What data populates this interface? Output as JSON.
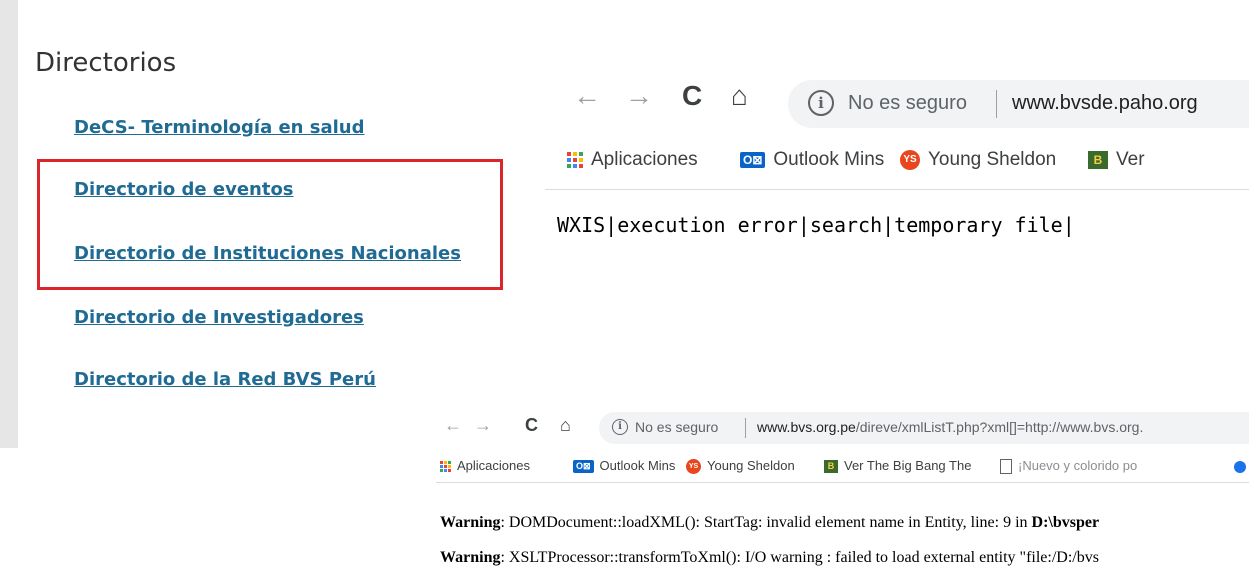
{
  "directorios": {
    "title": "Directorios",
    "links": [
      "DeCS- Terminología en salud",
      "Directorio de eventos",
      "Directorio de Instituciones Nacionales",
      "Directorio de Investigadores",
      "Directorio de la Red BVS Perú"
    ]
  },
  "browser1": {
    "nav": {
      "back": "←",
      "forward": "→",
      "reload": "C",
      "home": "⌂"
    },
    "info": "i",
    "security": "No es seguro",
    "url": "www.bvsde.paho.org",
    "bookmarks": {
      "apps": "Aplicaciones",
      "outlook": "Outlook Mins",
      "young_sheldon": "Young Sheldon",
      "ver": "Ver"
    },
    "error_text": "WXIS|execution error|search|temporary file|"
  },
  "browser2": {
    "nav": {
      "back": "←",
      "forward": "→",
      "reload": "C",
      "home": "⌂"
    },
    "info": "i",
    "security": "No es seguro",
    "url_host": "www.bvs.org.pe",
    "url_path": "/direve/xmlListT.php?xml[]=http://www.bvs.org.",
    "bookmarks": {
      "apps": "Aplicaciones",
      "outlook": "Outlook Mins",
      "young_sheldon": "Young Sheldon",
      "big_bang": "Ver The Big Bang The",
      "nuevo": "¡Nuevo y colorido po"
    },
    "warnings": [
      {
        "label": "Warning",
        "text": ": DOMDocument::loadXML(): StartTag: invalid element name in Entity, line: 9 in ",
        "bold_tail": "D:\\bvsper"
      },
      {
        "label": "Warning",
        "text": ": XSLTProcessor::transformToXml(): I/O warning : failed to load external entity \"file:/D:/bvs",
        "bold_tail": ""
      }
    ]
  },
  "colors": {
    "link": "#1f6b94",
    "highlight_border": "#d8262c",
    "sidebar": "#e6e6e6"
  }
}
